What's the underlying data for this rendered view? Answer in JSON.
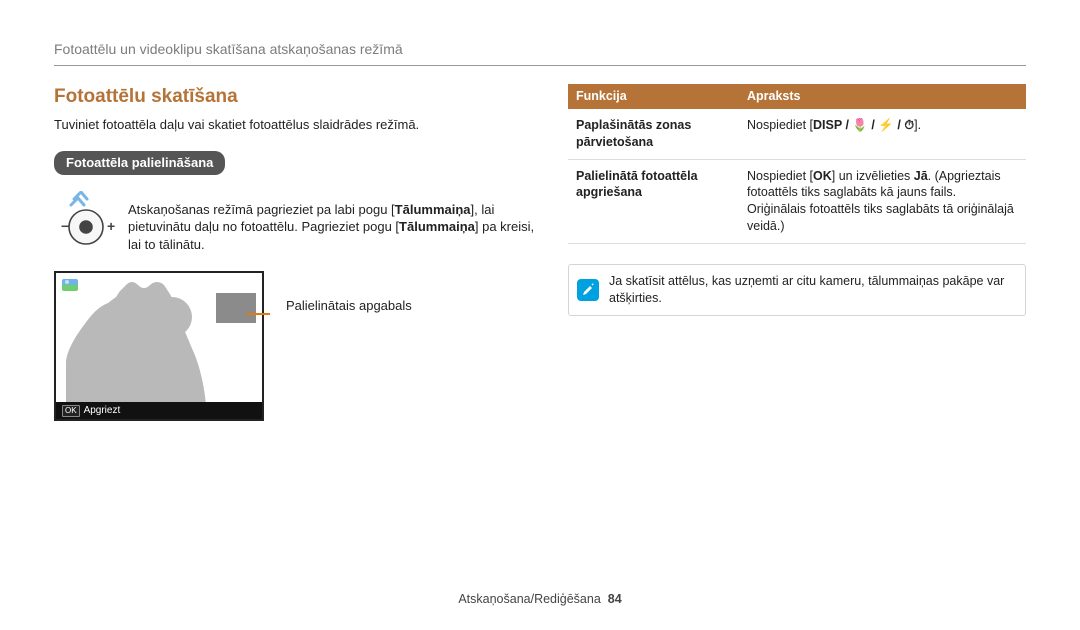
{
  "header": "Fotoattēlu un videoklipu skatīšana atskaņošanas režīmā",
  "section_title": "Fotoattēlu skatīšana",
  "lead": "Tuviniet fotoattēla daļu vai skatiet fotoattēlus slaidrādes režīmā.",
  "pill_title": "Fotoattēla palielināšana",
  "zoom_text": {
    "a": "Atskaņošanas režīmā pagrieziet pa labi pogu [",
    "b": "Tālummaiņa",
    "c": "], lai pietuvinātu daļu no fotoattēlu. Pagrieziet pogu [",
    "d": "Tālummaiņa",
    "e": "] pa kreisi, lai to tālinātu."
  },
  "preview": {
    "bar_ok": "OK",
    "bar_label": "Apgriezt",
    "callout": "Palielinātais apgabals"
  },
  "table": {
    "head_func": "Funkcija",
    "head_desc": "Apraksts",
    "rows": [
      {
        "label": "Paplašinātās zonas pārvietošana",
        "desc_pre": "Nospiediet [",
        "desc_keys": "DISP / 🌷 / ⚡ / ⏱",
        "desc_post": "]."
      },
      {
        "label": "Palielinātā fotoattēla apgriešana",
        "desc_pre": "Nospiediet [",
        "desc_keys": "OK",
        "desc_mid": "] un izvēlieties ",
        "desc_bold": "Jā",
        "desc_post": ". (Apgrieztais fotoattēls tiks saglabāts kā jauns fails. Oriģinālais fotoattēls tiks saglabāts tā oriģinālajā veidā.)"
      }
    ]
  },
  "note": "Ja skatīsit attēlus, kas uzņemti ar citu kameru, tālummaiņas pakāpe var atšķirties.",
  "footer_label": "Atskaņošana/Rediģēšana",
  "footer_page": "84",
  "icons": {
    "pencil": "pencil-icon",
    "dial": "zoom-dial-icon",
    "landscape": "landscape-thumb-icon"
  }
}
